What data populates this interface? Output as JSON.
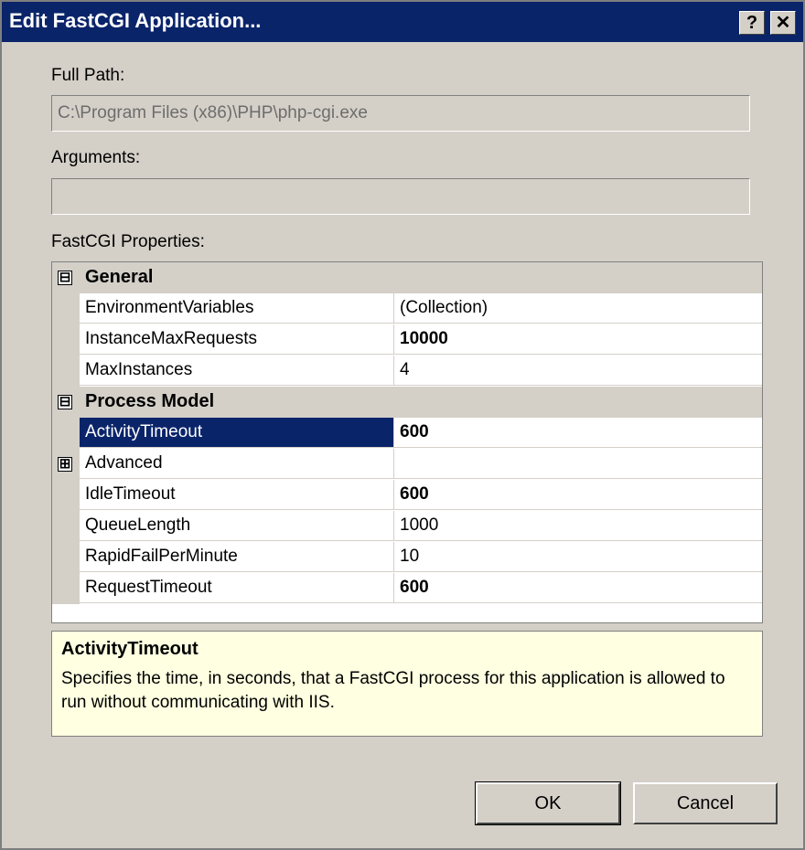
{
  "window": {
    "title": "Edit FastCGI Application...",
    "help_glyph": "?",
    "close_glyph": "✕"
  },
  "full_path": {
    "label": "Full Path:",
    "value": "C:\\Program Files (x86)\\PHP\\php-cgi.exe"
  },
  "arguments": {
    "label": "Arguments:",
    "value": ""
  },
  "properties": {
    "label": "FastCGI Properties:",
    "general": {
      "label": "General",
      "expander": "⊟",
      "rows": [
        {
          "name": "EnvironmentVariables",
          "value": "(Collection)"
        },
        {
          "name": "InstanceMaxRequests",
          "value": "10000"
        },
        {
          "name": "MaxInstances",
          "value": "4"
        }
      ]
    },
    "process_model": {
      "label": "Process Model",
      "expander": "⊟",
      "rows": [
        {
          "name": "ActivityTimeout",
          "value": "600"
        },
        {
          "name": "Advanced",
          "value": "",
          "expander": "⊞"
        },
        {
          "name": "IdleTimeout",
          "value": "600"
        },
        {
          "name": "QueueLength",
          "value": "1000"
        },
        {
          "name": "RapidFailPerMinute",
          "value": "10"
        },
        {
          "name": "RequestTimeout",
          "value": "600"
        }
      ]
    }
  },
  "description": {
    "title": "ActivityTimeout",
    "text": "Specifies the time, in seconds, that a FastCGI process for this application is allowed to run without communicating with IIS."
  },
  "buttons": {
    "ok": "OK",
    "cancel": "Cancel"
  },
  "colors": {
    "title_bar": "#0a246a",
    "selection": "#0a246a",
    "description_bg": "#ffffe1",
    "dialog_bg": "#d4d0c8"
  }
}
